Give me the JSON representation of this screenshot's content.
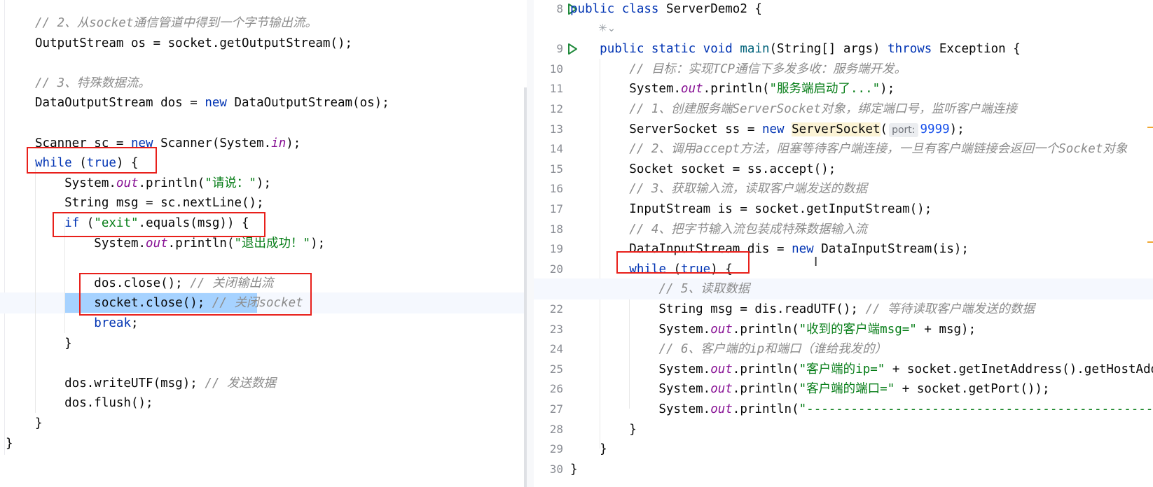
{
  "left_editor": {
    "lines": [
      [
        {
          "c": "cmt",
          "t": "// 2、从socket通信管道中得到一个字节输出流。"
        }
      ],
      [
        {
          "c": "",
          "t": "OutputStream os = socket.getOutputStream();"
        }
      ],
      [],
      [
        {
          "c": "cmt",
          "t": "// 3、特殊数据流。"
        }
      ],
      [
        {
          "c": "",
          "t": "DataOutputStream dos = "
        },
        {
          "c": "kw",
          "t": "new"
        },
        {
          "c": "",
          "t": " DataOutputStream(os);"
        }
      ],
      [],
      [
        {
          "c": "",
          "t": "Scanner sc = "
        },
        {
          "c": "kw",
          "t": "new"
        },
        {
          "c": "",
          "t": " Scanner(System."
        },
        {
          "c": "fld",
          "t": "in"
        },
        {
          "c": "",
          "t": ");"
        }
      ],
      [
        {
          "c": "kw",
          "t": "while"
        },
        {
          "c": "",
          "t": " ("
        },
        {
          "c": "kw",
          "t": "true"
        },
        {
          "c": "",
          "t": ") {"
        }
      ],
      [
        {
          "c": "",
          "t": "    System."
        },
        {
          "c": "fld",
          "t": "out"
        },
        {
          "c": "",
          "t": ".println("
        },
        {
          "c": "str",
          "t": "\"请说：\""
        },
        {
          "c": "",
          "t": ");"
        }
      ],
      [
        {
          "c": "",
          "t": "    String msg = sc.nextLine();"
        }
      ],
      [
        {
          "c": "",
          "t": "    "
        },
        {
          "c": "kw",
          "t": "if"
        },
        {
          "c": "",
          "t": " ("
        },
        {
          "c": "str",
          "t": "\"exit\""
        },
        {
          "c": "",
          "t": ".equals(msg)) {"
        }
      ],
      [
        {
          "c": "",
          "t": "        System."
        },
        {
          "c": "fld",
          "t": "out"
        },
        {
          "c": "",
          "t": ".println("
        },
        {
          "c": "str",
          "t": "\"退出成功！\""
        },
        {
          "c": "",
          "t": ");"
        }
      ],
      [],
      [
        {
          "c": "",
          "t": "        dos.close(); "
        },
        {
          "c": "cmt",
          "t": "// 关闭输出流"
        }
      ],
      [
        {
          "c": "",
          "t": "        socket.close(); "
        },
        {
          "c": "cmt",
          "t": "// 关闭socket"
        }
      ],
      [
        {
          "c": "",
          "t": "        "
        },
        {
          "c": "kw",
          "t": "break"
        },
        {
          "c": "",
          "t": ";"
        }
      ],
      [
        {
          "c": "",
          "t": "    }"
        }
      ],
      [],
      [
        {
          "c": "",
          "t": "    dos.writeUTF(msg); "
        },
        {
          "c": "cmt",
          "t": "// 发送数据"
        }
      ],
      [
        {
          "c": "",
          "t": "    dos.flush();"
        }
      ],
      [
        {
          "c": "",
          "t": "}"
        }
      ]
    ],
    "closing_brace": "}"
  },
  "right_editor": {
    "lines": [
      {
        "n": "8",
        "run": true,
        "segs": [
          {
            "c": "kw",
            "t": "public class"
          },
          {
            "c": "",
            "t": " ServerDemo2 {"
          }
        ]
      },
      {
        "n": "",
        "run": false,
        "segs": []
      },
      {
        "n": "9",
        "run": true,
        "segs": [
          {
            "c": "",
            "t": "    "
          },
          {
            "c": "kw",
            "t": "public static void"
          },
          {
            "c": "",
            "t": " "
          },
          {
            "c": "meth",
            "t": "main"
          },
          {
            "c": "",
            "t": "(String[] args) "
          },
          {
            "c": "kw",
            "t": "throws"
          },
          {
            "c": "",
            "t": " Exception {"
          }
        ]
      },
      {
        "n": "10",
        "segs": [
          {
            "c": "",
            "t": "        "
          },
          {
            "c": "cmt",
            "t": "// 目标：实现TCP通信下多发多收：服务端开发。"
          }
        ]
      },
      {
        "n": "11",
        "segs": [
          {
            "c": "",
            "t": "        System."
          },
          {
            "c": "fld",
            "t": "out"
          },
          {
            "c": "",
            "t": ".println("
          },
          {
            "c": "str",
            "t": "\"服务端启动了...\""
          },
          {
            "c": "",
            "t": ");"
          }
        ]
      },
      {
        "n": "12",
        "segs": [
          {
            "c": "",
            "t": "        "
          },
          {
            "c": "cmt",
            "t": "// 1、创建服务端ServerSocket对象，绑定端口号，监听客户端连接"
          }
        ]
      },
      {
        "n": "13",
        "segs": [
          {
            "c": "",
            "t": "        ServerSocket ss = "
          },
          {
            "c": "kw",
            "t": "new"
          },
          {
            "c": "",
            "t": " "
          },
          {
            "c": "warn",
            "t": "ServerSocket"
          },
          {
            "c": "",
            "t": "("
          },
          {
            "c": "hint",
            "t": "port:"
          },
          {
            "c": "num",
            "t": "9999"
          },
          {
            "c": "",
            "t": ");"
          }
        ]
      },
      {
        "n": "14",
        "segs": [
          {
            "c": "",
            "t": "        "
          },
          {
            "c": "cmt",
            "t": "// 2、调用accept方法，阻塞等待客户端连接，一旦有客户端链接会返回一个Socket对象"
          }
        ]
      },
      {
        "n": "15",
        "segs": [
          {
            "c": "",
            "t": "        Socket socket = ss.accept();"
          }
        ]
      },
      {
        "n": "16",
        "segs": [
          {
            "c": "",
            "t": "        "
          },
          {
            "c": "cmt",
            "t": "// 3、获取输入流，读取客户端发送的数据"
          }
        ]
      },
      {
        "n": "17",
        "segs": [
          {
            "c": "",
            "t": "        InputStream is = socket.getInputStream();"
          }
        ]
      },
      {
        "n": "18",
        "segs": [
          {
            "c": "",
            "t": "        "
          },
          {
            "c": "cmt",
            "t": "// 4、把字节输入流包装成特殊数据输入流"
          }
        ]
      },
      {
        "n": "19",
        "segs": [
          {
            "c": "",
            "t": "        DataInputStream dis = "
          },
          {
            "c": "kw",
            "t": "new"
          },
          {
            "c": "",
            "t": " DataInputStream(is);"
          }
        ]
      },
      {
        "n": "20",
        "segs": [
          {
            "c": "",
            "t": "        "
          },
          {
            "c": "kw",
            "t": "while"
          },
          {
            "c": "",
            "t": " ("
          },
          {
            "c": "kw",
            "t": "true"
          },
          {
            "c": "",
            "t": ") {"
          }
        ]
      },
      {
        "n": "21",
        "current": true,
        "segs": [
          {
            "c": "",
            "t": "            "
          },
          {
            "c": "cmt",
            "t": "// 5、读取数据"
          }
        ]
      },
      {
        "n": "22",
        "segs": [
          {
            "c": "",
            "t": "            String msg = dis.readUTF(); "
          },
          {
            "c": "cmt",
            "t": "// 等待读取客户端发送的数据"
          }
        ]
      },
      {
        "n": "23",
        "segs": [
          {
            "c": "",
            "t": "            System."
          },
          {
            "c": "fld",
            "t": "out"
          },
          {
            "c": "",
            "t": ".println("
          },
          {
            "c": "str",
            "t": "\"收到的客户端msg=\""
          },
          {
            "c": "",
            "t": " + msg);"
          }
        ]
      },
      {
        "n": "24",
        "segs": [
          {
            "c": "",
            "t": "            "
          },
          {
            "c": "cmt",
            "t": "// 6、客户端的ip和端口（谁给我发的）"
          }
        ]
      },
      {
        "n": "25",
        "segs": [
          {
            "c": "",
            "t": "            System."
          },
          {
            "c": "fld",
            "t": "out"
          },
          {
            "c": "",
            "t": ".println("
          },
          {
            "c": "str",
            "t": "\"客户端的ip=\""
          },
          {
            "c": "",
            "t": " + socket.getInetAddress().getHostAddress());"
          }
        ]
      },
      {
        "n": "26",
        "segs": [
          {
            "c": "",
            "t": "            System."
          },
          {
            "c": "fld",
            "t": "out"
          },
          {
            "c": "",
            "t": ".println("
          },
          {
            "c": "str",
            "t": "\"客户端的端口=\""
          },
          {
            "c": "",
            "t": " + socket.getPort());"
          }
        ]
      },
      {
        "n": "27",
        "segs": [
          {
            "c": "",
            "t": "            System."
          },
          {
            "c": "fld",
            "t": "out"
          },
          {
            "c": "",
            "t": ".println("
          },
          {
            "c": "str",
            "t": "\"------------------------------------------------\""
          },
          {
            "c": "",
            "t": ");"
          }
        ]
      },
      {
        "n": "28",
        "segs": [
          {
            "c": "",
            "t": "        }"
          }
        ]
      },
      {
        "n": "29",
        "segs": [
          {
            "c": "",
            "t": "    }"
          }
        ]
      },
      {
        "n": "30",
        "segs": [
          {
            "c": "",
            "t": "}"
          }
        ]
      }
    ]
  },
  "colors": {
    "keyword": "#0033b3",
    "string": "#067d17",
    "comment": "#8c8c8c",
    "field": "#871094",
    "number": "#1750eb",
    "highlight_box": "#e8201b",
    "selection": "#a6d2ff",
    "run_icon": "#208a3c"
  },
  "icons": {
    "run": "run-gutter-icon",
    "ai_assist": "ai-assistant-icon",
    "text_cursor": "text-cursor-icon"
  }
}
